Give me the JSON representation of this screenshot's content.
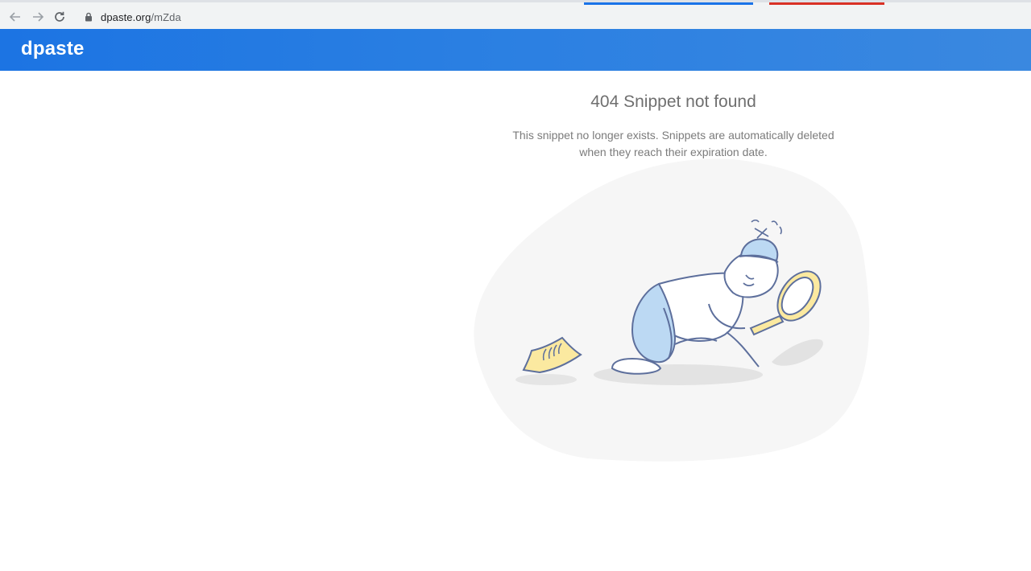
{
  "browser": {
    "url_domain": "dpaste.org",
    "url_path": "/mZda",
    "icons": [
      "back-arrow-icon",
      "forward-arrow-icon",
      "reload-icon",
      "lock-icon"
    ]
  },
  "header": {
    "brand": "dpaste"
  },
  "error": {
    "title": "404 Snippet not found",
    "description": "This snippet no longer exists. Snippets are automatically deleted when they reach their expiration date."
  },
  "colors": {
    "header_blue": "#1c74e3",
    "illustration_blue": "#bcd9f3",
    "illustration_yellow": "#fbe9a0",
    "outline": "#5d6f9c"
  }
}
